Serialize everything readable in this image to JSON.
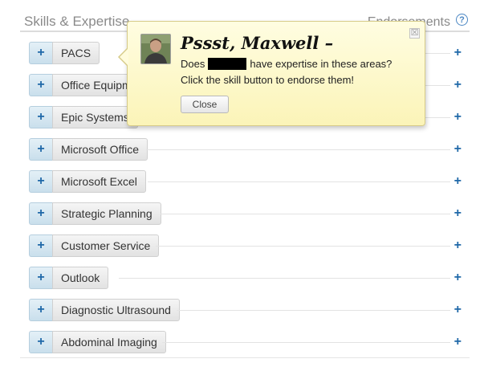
{
  "section": {
    "title": "Skills & Expertise",
    "endorsements_label": "Endorsements",
    "help_icon_text": "?"
  },
  "skill_plus_glyph": "+",
  "skills": [
    {
      "name": "PACS"
    },
    {
      "name": "Office Equipment"
    },
    {
      "name": "Epic Systems"
    },
    {
      "name": "Microsoft Office"
    },
    {
      "name": "Microsoft Excel"
    },
    {
      "name": "Strategic Planning"
    },
    {
      "name": "Customer Service"
    },
    {
      "name": "Outlook"
    },
    {
      "name": "Diagnostic Ultrasound"
    },
    {
      "name": "Abdominal Imaging"
    }
  ],
  "popup": {
    "title": "Pssst, Maxwell –",
    "line1_before": "Does",
    "line1_after": "have expertise in these areas?",
    "line2": "Click the skill button to endorse them!",
    "close_button_label": "Close",
    "close_x": "☒"
  },
  "colors": {
    "accent_blue": "#1f68a8",
    "popup_bg": "#fffde1",
    "popup_border": "#d6cb88"
  }
}
